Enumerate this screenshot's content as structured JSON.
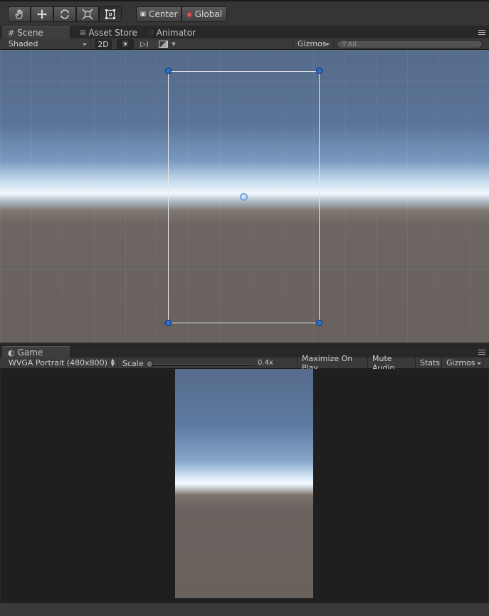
{
  "toolbar": {
    "tools": [
      {
        "icon": "hand-icon"
      },
      {
        "icon": "move-icon"
      },
      {
        "icon": "rotate-icon"
      },
      {
        "icon": "scale-icon"
      },
      {
        "icon": "rect-tool-icon",
        "selected": true
      }
    ],
    "pivot_mode": "Center",
    "pivot_rotation": "Global"
  },
  "scene_panel": {
    "tabs": [
      {
        "label": "Scene",
        "icon": "scene-grid-icon",
        "active": true
      },
      {
        "label": "Asset Store",
        "icon": "asset-store-icon",
        "active": false
      },
      {
        "label": "Animator",
        "icon": "animator-icon",
        "active": false
      }
    ],
    "shading_mode": "Shaded",
    "mode_2d": "2D",
    "gizmos_label": "Gizmos",
    "search_placeholder": "All"
  },
  "game_panel": {
    "tab_label": "Game",
    "aspect": "WVGA Portrait (480x800)",
    "scale_label": "Scale",
    "scale_value": "0.4x",
    "maximize_label": "Maximize On Play",
    "mute_label": "Mute Audio",
    "stats_label": "Stats",
    "gizmos_label": "Gizmos"
  },
  "colors": {
    "selection_handle": "#2c6fd6",
    "panel_bg": "#3a3a3a"
  }
}
